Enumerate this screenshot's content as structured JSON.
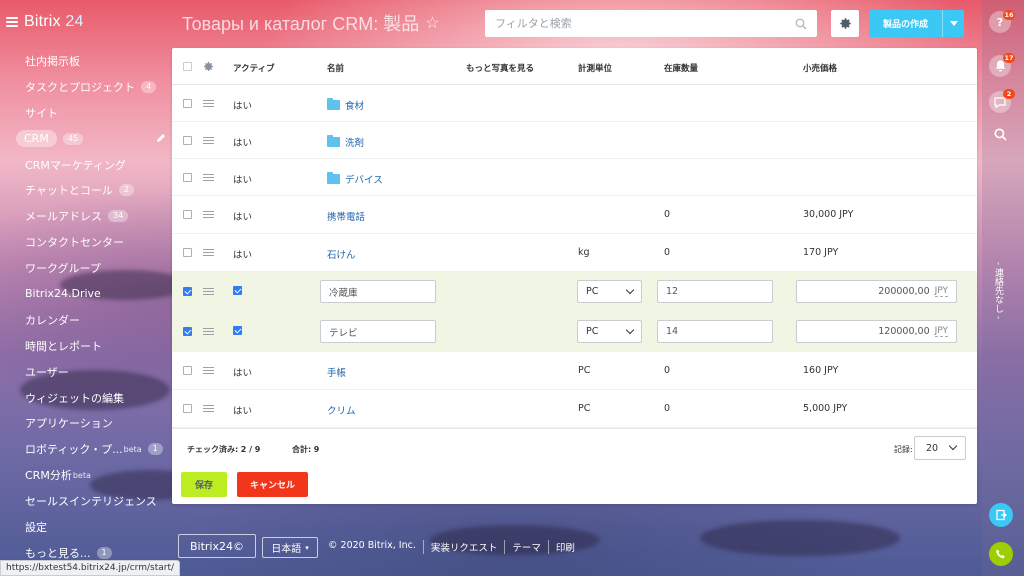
{
  "app": {
    "logo_main": "Bitrix",
    "logo_suffix": "24",
    "page_title": "Товары и каталог CRM: 製品"
  },
  "sidebar": {
    "items": [
      {
        "label": "社内掲示板",
        "count": ""
      },
      {
        "label": "タスクとプロジェクト",
        "count": "4"
      },
      {
        "label": "サイト",
        "count": ""
      },
      {
        "label": "CRM",
        "count": "45"
      },
      {
        "label": "CRMマーケティング",
        "count": ""
      },
      {
        "label": "チャットとコール",
        "count": "2"
      },
      {
        "label": "メールアドレス",
        "count": "34"
      },
      {
        "label": "コンタクトセンター",
        "count": ""
      },
      {
        "label": "ワークグループ",
        "count": ""
      },
      {
        "label": "Bitrix24.Drive",
        "count": ""
      },
      {
        "label": "カレンダー",
        "count": ""
      },
      {
        "label": "時間とレポート",
        "count": ""
      },
      {
        "label": "ユーザー",
        "count": ""
      },
      {
        "label": "ウィジェットの編集",
        "count": ""
      },
      {
        "label": "アプリケーション",
        "count": ""
      },
      {
        "label": "ロボティック・プ...",
        "sup": "beta",
        "count": "1"
      },
      {
        "label": "CRM分析",
        "sup": "beta",
        "count": ""
      },
      {
        "label": "セールスインテリジェンス",
        "count": ""
      },
      {
        "label": "設定",
        "count": ""
      },
      {
        "label": "もっと見る...",
        "count": "1"
      }
    ]
  },
  "toolbar": {
    "search_placeholder": "フィルタと検索",
    "create_label": "製品の作成"
  },
  "grid": {
    "columns": [
      "アクティブ",
      "名前",
      "もっと写真を見る",
      "計測単位",
      "在庫数量",
      "小売価格"
    ],
    "rows": [
      {
        "checked": false,
        "active": "はい",
        "name": "食材",
        "folder": true,
        "unit": "",
        "qty": "",
        "price": ""
      },
      {
        "checked": false,
        "active": "はい",
        "name": "洗剤",
        "folder": true,
        "unit": "",
        "qty": "",
        "price": ""
      },
      {
        "checked": false,
        "active": "はい",
        "name": "デバイス",
        "folder": true,
        "unit": "",
        "qty": "",
        "price": ""
      },
      {
        "checked": false,
        "active": "はい",
        "name": "携帯電話",
        "folder": false,
        "unit": "",
        "qty": "0",
        "price": "30,000 JPY"
      },
      {
        "checked": false,
        "active": "はい",
        "name": "石けん",
        "folder": false,
        "unit": "kg",
        "qty": "0",
        "price": "170 JPY"
      },
      {
        "checked": true,
        "edit": true,
        "name": "冷蔵庫",
        "unit": "PC",
        "qty": "12",
        "price": "200000,00",
        "currency": "JPY"
      },
      {
        "checked": true,
        "edit": true,
        "name": "テレビ",
        "unit": "PC",
        "qty": "14",
        "price": "120000,00",
        "currency": "JPY"
      },
      {
        "checked": false,
        "active": "はい",
        "name": "手帳",
        "folder": false,
        "unit": "PC",
        "qty": "0",
        "price": "160 JPY"
      },
      {
        "checked": false,
        "active": "はい",
        "name": "クリム",
        "folder": false,
        "unit": "PC",
        "qty": "0",
        "price": "5,000 JPY"
      }
    ],
    "footer": {
      "checked_label": "チェック済み:",
      "checked_value": "2 / 9",
      "total_label": "合計:",
      "total_value": "9",
      "records_label": "記録:",
      "records_value": "20"
    },
    "save_label": "保存",
    "cancel_label": "キャンセル"
  },
  "rail": {
    "help_badge": "16",
    "bell_badge": "17",
    "chat_badge": "2",
    "contacts_vertical": "- 連絡先なし -"
  },
  "footer": {
    "logo": "Bitrix24©",
    "language": "日本語",
    "links": [
      "© 2020 Bitrix, Inc.",
      "実装リクエスト",
      "テーマ",
      "印刷"
    ]
  },
  "status_url": "https://bxtest54.bitrix24.jp/crm/start/",
  "colors": {
    "accent": "#3bc8f5",
    "save": "#bbed21",
    "cancel": "#f1361b",
    "checkbox": "#2f7cf6",
    "edit_row": "#f0f6e3",
    "link": "#2067b0",
    "badge": "#f54819"
  }
}
